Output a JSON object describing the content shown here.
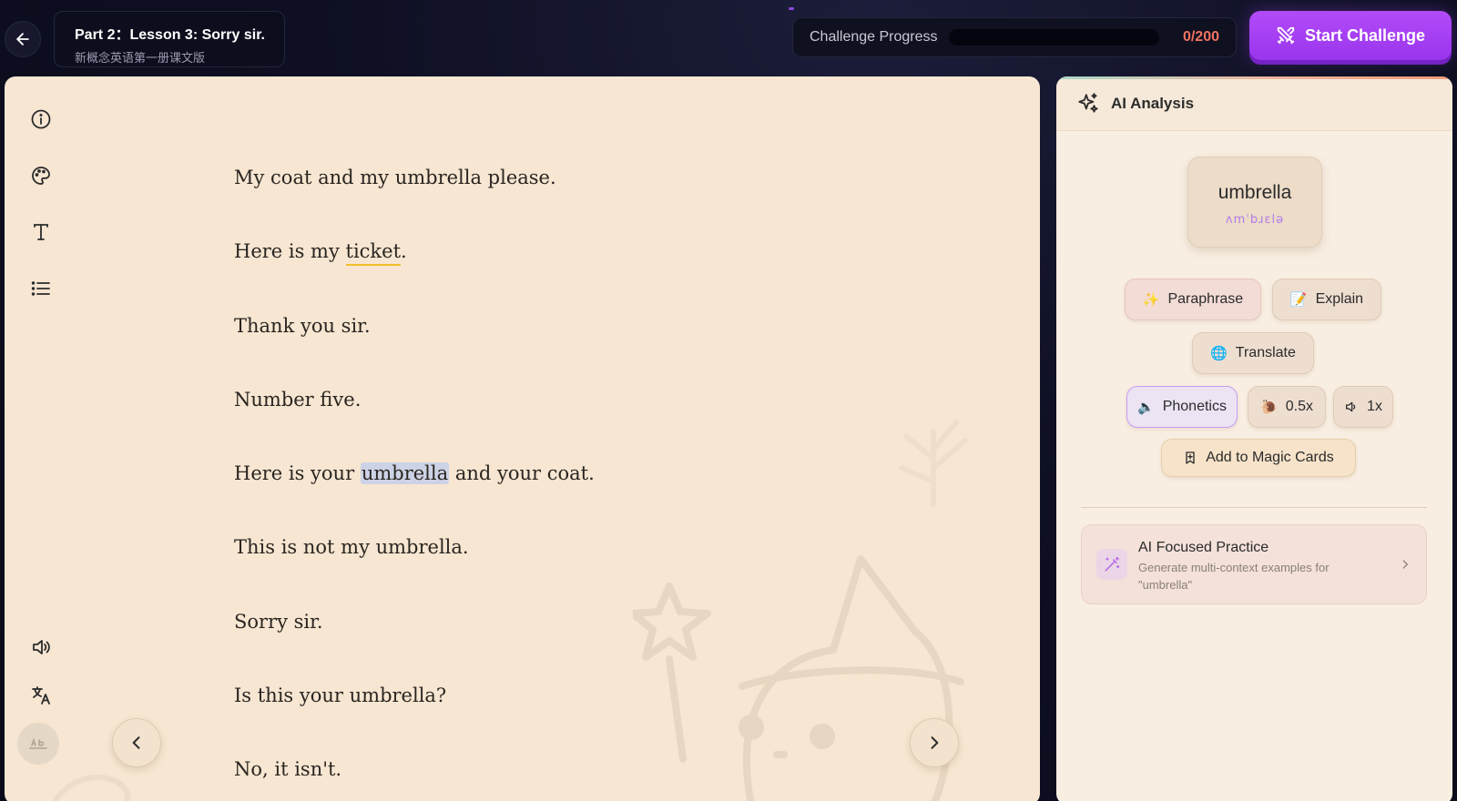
{
  "header": {
    "lesson_title": "Part 2：Lesson 3: Sorry sir.",
    "lesson_subtitle": "新概念英语第一册课文版",
    "progress_label": "Challenge Progress",
    "progress_count": "0/200",
    "progress_fraction": 0,
    "start_label": "Start Challenge"
  },
  "reader": {
    "lines": [
      "My coat and my umbrella please.",
      "Here is my",
      "ticket",
      ".",
      "Thank you sir.",
      "Number five.",
      "Here is your",
      "umbrella",
      "and your coat.",
      "This is not my umbrella.",
      "Sorry sir.",
      "Is this your umbrella?",
      "No, it isn't."
    ]
  },
  "ai": {
    "title": "AI Analysis",
    "word": "umbrella",
    "phonetic": "ʌmˈbɹɛlə",
    "paraphrase_label": "Paraphrase",
    "paraphrase_emoji": "✨",
    "explain_label": "Explain",
    "explain_emoji": "📝",
    "translate_label": "Translate",
    "translate_emoji": "🌐",
    "phonetics_label": "Phonetics",
    "phonetics_emoji": "🔈",
    "slow_label": "0.5x",
    "slow_emoji": "🐌",
    "normal_label": "1x",
    "magic_label": "Add to Magic Cards",
    "practice_title": "AI Focused Practice",
    "practice_desc": "Generate multi-context examples for \"umbrella\""
  },
  "colors": {
    "accent_purple": "#a23ff3",
    "progress_red": "#f07360",
    "reader_bg": "#f6e6d2",
    "highlight_underline": "#f2c02c"
  }
}
